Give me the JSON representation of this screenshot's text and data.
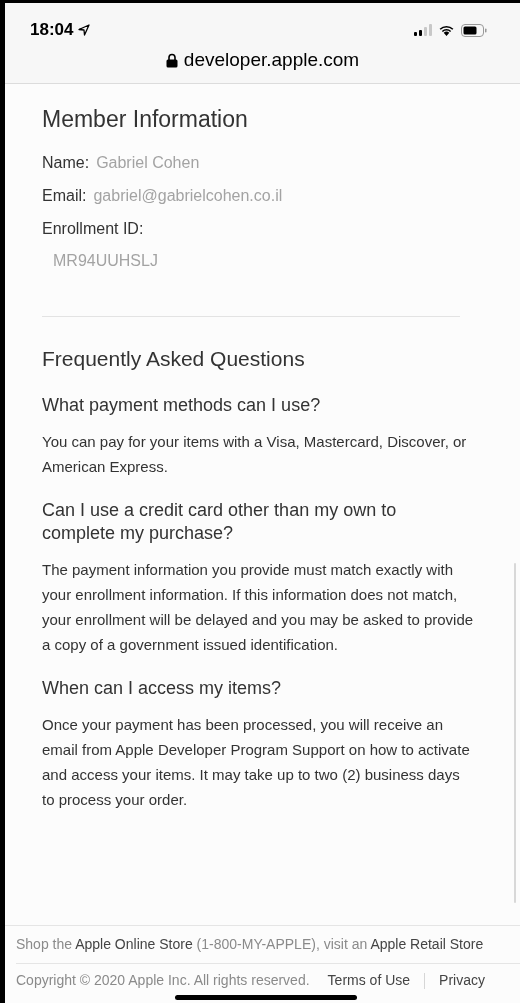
{
  "status_bar": {
    "time": "18:04"
  },
  "address_bar": {
    "url": "developer.apple.com"
  },
  "member_information": {
    "title": "Member Information",
    "fields": [
      {
        "label": "Name:",
        "value": "Gabriel Cohen",
        "kind": "inline"
      },
      {
        "label": "Email:",
        "value": "gabriel@gabrielcohen.co.il",
        "kind": "inline"
      },
      {
        "label": "Enrollment ID:",
        "value": "MR94UUHSLJ",
        "kind": "below"
      }
    ]
  },
  "faq": {
    "title": "Frequently Asked Questions",
    "items": [
      {
        "question": "What payment methods can I use?",
        "answer": "You can pay for your items with a Visa, Mastercard, Discover, or American Express."
      },
      {
        "question": "Can I use a credit card other than my own to complete my purchase?",
        "answer": "The payment information you provide must match exactly with your enrollment information. If this information does not match, your enrollment will be delayed and you may be asked to provide a copy of a government issued identification."
      },
      {
        "question": "When can I access my items?",
        "answer": "Once your payment has been processed, you will receive an email from Apple Developer Program Support on how to activate and access your items. It may take up to two (2) business days to process your order."
      }
    ]
  },
  "footer": {
    "shop_line": [
      {
        "text": "Shop the ",
        "kind": "plain"
      },
      {
        "text": "Apple Online Store",
        "kind": "link"
      },
      {
        "text": " (1-800-MY-APPLE), visit an ",
        "kind": "plain"
      },
      {
        "text": "Apple Retail Store",
        "kind": "link"
      }
    ],
    "copyright": "Copyright © 2020 Apple Inc. All rights reserved.",
    "links": [
      "Terms of Use",
      "Privacy"
    ]
  }
}
